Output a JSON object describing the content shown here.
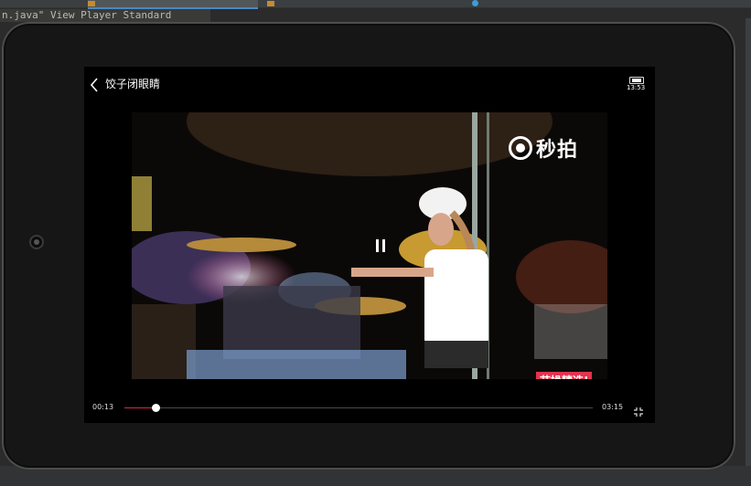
{
  "ide": {
    "code_line": "n.java\" View Player Standard",
    "tab_labels": [
      "",
      "",
      ""
    ]
  },
  "video": {
    "title": "饺子闭眼睛",
    "status_time": "13:53",
    "watermark": "秒拍",
    "corner_badge": "节操精选!",
    "current_time": "00:13",
    "total_time": "03:15",
    "progress": 0.0667,
    "is_playing": true
  },
  "icons": {
    "back": "chevron-left-icon",
    "pause": "pause-icon",
    "battery": "battery-icon",
    "shrink": "exit-fullscreen-icon",
    "watermark_logo": "camera-logo-icon"
  },
  "colors": {
    "progress": "#d02b45",
    "badge": "#e2334f",
    "background": "#000000"
  }
}
